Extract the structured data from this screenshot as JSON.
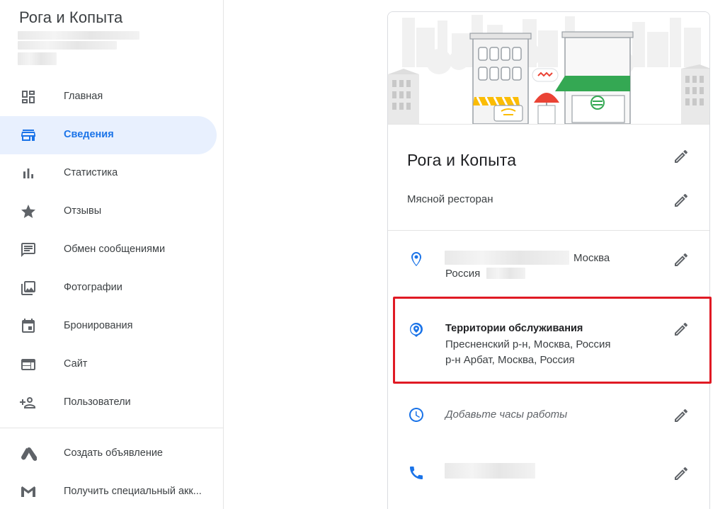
{
  "sidebar": {
    "business_name": "Рога и Копыта",
    "items": [
      {
        "label": "Главная",
        "icon": "dashboard-icon"
      },
      {
        "label": "Сведения",
        "icon": "storefront-icon",
        "active": true
      },
      {
        "label": "Статистика",
        "icon": "bar-chart-icon"
      },
      {
        "label": "Отзывы",
        "icon": "star-icon"
      },
      {
        "label": "Обмен сообщениями",
        "icon": "message-icon"
      },
      {
        "label": "Фотографии",
        "icon": "photo-library-icon"
      },
      {
        "label": "Бронирования",
        "icon": "calendar-icon"
      },
      {
        "label": "Сайт",
        "icon": "web-icon"
      },
      {
        "label": "Пользователи",
        "icon": "person-add-icon"
      }
    ],
    "secondary_items": [
      {
        "label": "Создать объявление",
        "icon": "google-ads-icon"
      },
      {
        "label": "Получить специальный акк...",
        "icon": "gmail-icon"
      }
    ]
  },
  "card": {
    "title": "Рога и Копыта",
    "category": "Мясной ресторан",
    "address": {
      "city": "Москва",
      "country": "Россия"
    },
    "service_area": {
      "heading": "Территории обслуживания",
      "lines": [
        "Пресненский р-н, Москва, Россия",
        "р-н Арбат, Москва, Россия"
      ]
    },
    "hours_placeholder": "Добавьте часы работы"
  },
  "colors": {
    "accent": "#1a73e8",
    "active_bg": "#e8f0fe",
    "highlight": "#e01a24",
    "icon_gray": "#5f6368"
  }
}
